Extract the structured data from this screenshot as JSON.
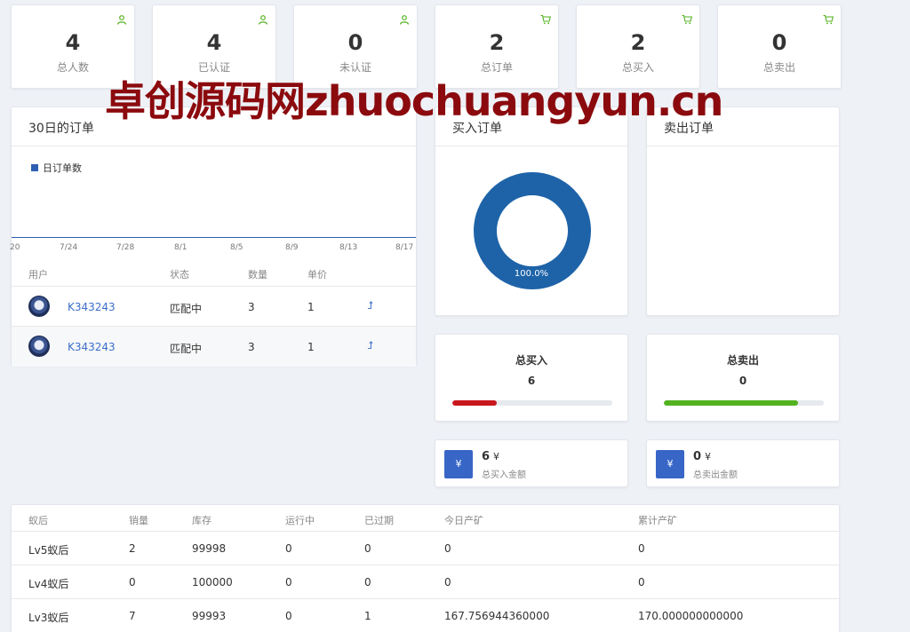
{
  "stats": [
    {
      "value": "4",
      "label": "总人数",
      "icon": "user-icon"
    },
    {
      "value": "4",
      "label": "已认证",
      "icon": "user-icon"
    },
    {
      "value": "0",
      "label": "未认证",
      "icon": "user-icon"
    },
    {
      "value": "2",
      "label": "总订单",
      "icon": "cart-icon"
    },
    {
      "value": "2",
      "label": "总买入",
      "icon": "cart-icon"
    },
    {
      "value": "0",
      "label": "总卖出",
      "icon": "cart-icon"
    }
  ],
  "watermark": "卓创源码网zhuochuangyun.cn",
  "orders_panel": {
    "title": "30日的订单",
    "legend": "日订单数",
    "ticks": [
      "20",
      "7/24",
      "7/28",
      "8/1",
      "8/5",
      "8/9",
      "8/13",
      "8/17"
    ],
    "headers": {
      "user": "用户",
      "status": "状态",
      "qty": "数量",
      "price": "单价"
    },
    "rows": [
      {
        "user": "K343243",
        "status": "匹配中",
        "qty": "3",
        "price": "1"
      },
      {
        "user": "K343243",
        "status": "匹配中",
        "qty": "3",
        "price": "1"
      }
    ]
  },
  "buy_panel": {
    "title": "买入订单",
    "percent_label": "100.0%"
  },
  "sell_panel": {
    "title": "卖出订单"
  },
  "total_buy": {
    "title": "总买入",
    "value": "6",
    "progress": 0.28,
    "color": "#c8161d"
  },
  "total_sell": {
    "title": "总卖出",
    "value": "0",
    "progress": 0.84,
    "color": "#52b21f"
  },
  "buy_amount": {
    "icon": "¥",
    "value": "6",
    "currency": "¥",
    "label": "总买入金额"
  },
  "sell_amount": {
    "icon": "¥",
    "value": "0",
    "currency": "¥",
    "label": "总卖出金额"
  },
  "queen_table": {
    "headers": [
      "蚁后",
      "销量",
      "库存",
      "运行中",
      "已过期",
      "今日产矿",
      "累计产矿"
    ],
    "rows": [
      [
        "Lv5蚁后",
        "2",
        "99998",
        "0",
        "0",
        "0",
        "0"
      ],
      [
        "Lv4蚁后",
        "0",
        "100000",
        "0",
        "0",
        "0",
        "0"
      ],
      [
        "Lv3蚁后",
        "7",
        "99993",
        "0",
        "1",
        "167.756944360000",
        "170.000000000000"
      ]
    ]
  },
  "colors": {
    "accent": "#3766c7",
    "donut": "#1e63a8",
    "icon_green": "#52b21f"
  }
}
